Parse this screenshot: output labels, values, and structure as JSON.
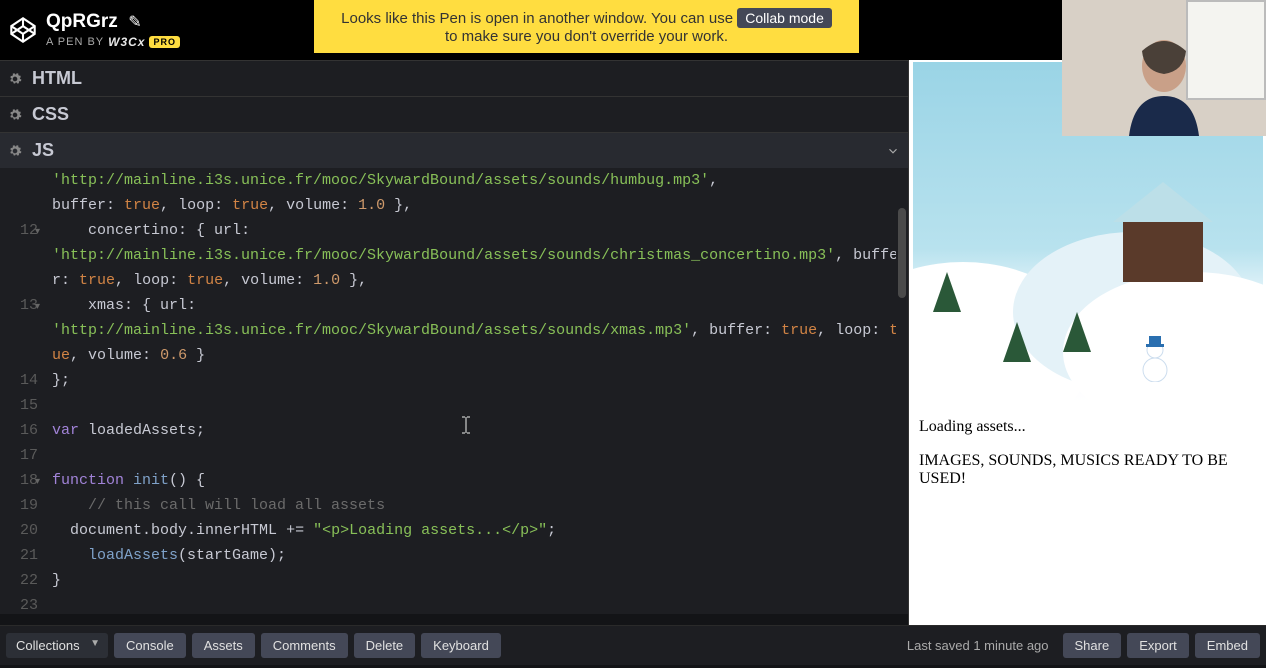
{
  "header": {
    "pen_title": "QpRGrz",
    "pen_by_prefix": "A PEN BY",
    "author": "W3Cx",
    "pro_label": "PRO"
  },
  "notice": {
    "text_before": "Looks like this Pen is open in another window. You can use ",
    "collab_label": "Collab mode",
    "text_after": " to make sure you don't override your work."
  },
  "panels": {
    "html": "HTML",
    "css": "CSS",
    "js": "JS"
  },
  "code": {
    "partial_top_url": "'http://mainline.i3s.unice.fr/mooc/SkywardBound/assets/sounds/humbug.mp3',",
    "partial_top_tail": "buffer: true, loop: true, volume: 1.0 },",
    "l12a": "    concertino: { url:",
    "l12b": "'http://mainline.i3s.unice.fr/mooc/SkywardBound/assets/sounds/christmas_concertino.mp3', buffer: true, loop: true, volume: 1.0 },",
    "l13a": "    xmas: { url:",
    "l13b": "'http://mainline.i3s.unice.fr/mooc/SkywardBound/assets/sounds/xmas.mp3', buffer: true, loop: true, volume: 0.6 }",
    "l14": "};",
    "l15": "",
    "l16": "var loadedAssets;",
    "l17": "",
    "l18": "function init() {",
    "l19": "    // this call will load all assets",
    "l20": "  document.body.innerHTML += \"<p>Loading assets...</p>\";",
    "l21": "    loadAssets(startGame);",
    "l22": "}",
    "l23": ""
  },
  "line_numbers": [
    "",
    "",
    "12",
    "",
    "",
    "13",
    "",
    "",
    "14",
    "15",
    "16",
    "17",
    "18",
    "19",
    "20",
    "21",
    "22",
    "23"
  ],
  "output": {
    "line1": "Loading assets...",
    "line2": "IMAGES, SOUNDS, MUSICS READY TO BE USED!"
  },
  "footer": {
    "collections": "Collections",
    "console": "Console",
    "assets": "Assets",
    "comments": "Comments",
    "delete": "Delete",
    "keyboard": "Keyboard",
    "saved": "Last saved 1 minute ago",
    "share": "Share",
    "export": "Export",
    "embed": "Embed"
  }
}
